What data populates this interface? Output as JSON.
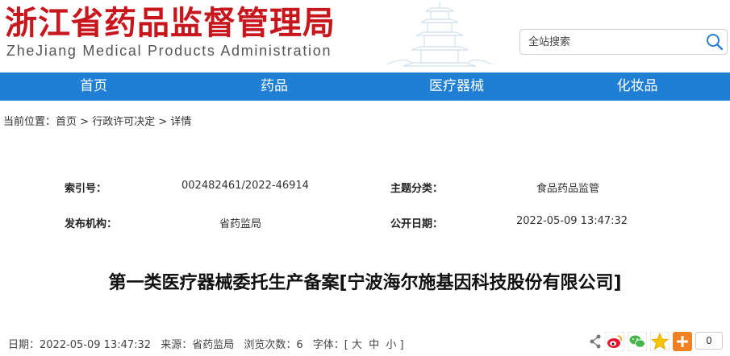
{
  "header": {
    "title": "浙江省药品监督管理局",
    "subtitle": "ZheJiang Medical Products Administration",
    "search": {
      "placeholder": "全站搜索",
      "icon": "search-icon"
    }
  },
  "nav": {
    "items": [
      {
        "label": "首页"
      },
      {
        "label": "药品"
      },
      {
        "label": "医疗器械"
      },
      {
        "label": "化妆品"
      }
    ]
  },
  "breadcrumb": {
    "prefix": "当前位置：",
    "items": [
      "首页",
      "行政许可决定",
      "详情"
    ],
    "separator": " > "
  },
  "meta": {
    "index_label": "索引号：",
    "index_value": "002482461/2022-46914",
    "topic_label": "主题分类：",
    "topic_value": "食品药品监管",
    "publisher_label": "发布机构：",
    "publisher_value": "省药监局",
    "date_label": "公开日期：",
    "date_value": "2022-05-09 13:47:32"
  },
  "article": {
    "title": "第一类医疗器械委托生产备案[宁波海尔施基因科技股份有限公司]"
  },
  "info": {
    "date": "日期：2022-05-09 13:47:32",
    "source": "来源：省药监局",
    "views": "浏览次数：6",
    "font_label": "字体：[",
    "font_large": "大",
    "font_medium": "中",
    "font_small": "小",
    "font_close": "]"
  },
  "share": {
    "count": "0",
    "icons": [
      "share-icon",
      "weibo-icon",
      "wechat-icon",
      "qzone-icon",
      "more-icon"
    ]
  },
  "colors": {
    "brand_red": "#c8161d",
    "nav_blue": "#1e7fd5"
  }
}
